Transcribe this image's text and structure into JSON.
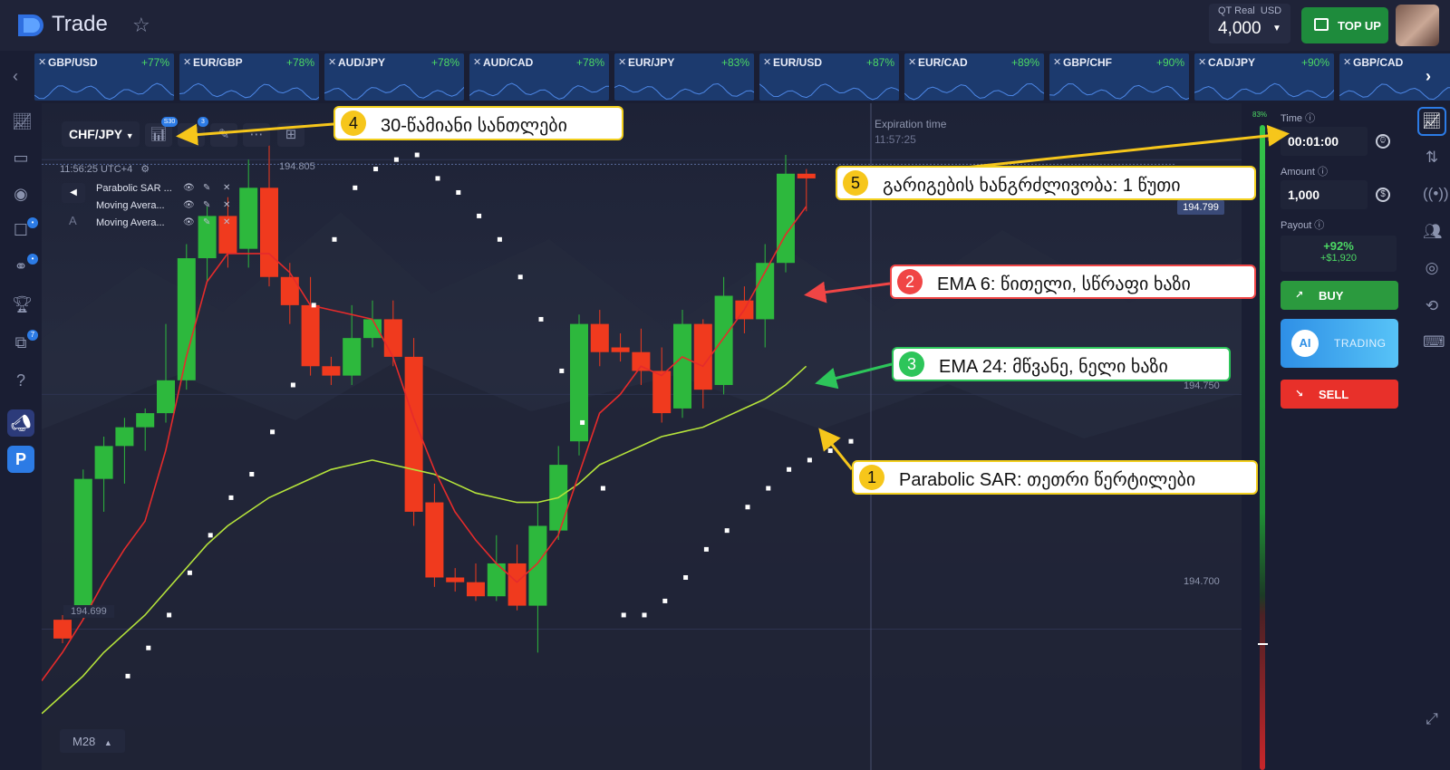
{
  "header": {
    "brand": "Trade",
    "account_type": "QT Real",
    "account_currency": "USD",
    "balance": "4,000",
    "top_up_label": "TOP UP"
  },
  "tickers": [
    {
      "pair": "GBP/USD",
      "payout": "+77%"
    },
    {
      "pair": "EUR/GBP",
      "payout": "+78%"
    },
    {
      "pair": "AUD/JPY",
      "payout": "+78%"
    },
    {
      "pair": "AUD/CAD",
      "payout": "+78%"
    },
    {
      "pair": "EUR/JPY",
      "payout": "+83%"
    },
    {
      "pair": "EUR/USD",
      "payout": "+87%"
    },
    {
      "pair": "EUR/CAD",
      "payout": "+89%"
    },
    {
      "pair": "GBP/CHF",
      "payout": "+90%"
    },
    {
      "pair": "CAD/JPY",
      "payout": "+90%"
    },
    {
      "pair": "GBP/CAD",
      "payout": ""
    }
  ],
  "chart": {
    "symbol": "CHF/JPY",
    "candle_badge": "S30",
    "indicator_badge": "3",
    "server_time": "11:56:25 UTC+4",
    "high_price": "194.805",
    "low_price": "194.699",
    "current_price": "194.799",
    "price_levels": [
      "194.750",
      "194.700"
    ],
    "expiration_label": "Expiration time",
    "expiration_value": "11:57:25",
    "timeframe": "M28",
    "indicators": [
      {
        "name": "Parabolic SAR ..."
      },
      {
        "name": "Moving Avera..."
      },
      {
        "name": "Moving Avera..."
      }
    ],
    "colors": {
      "up": "#2db83d",
      "down": "#f03a1e",
      "ema_fast": "#e52b2b",
      "ema_slow": "#b5e33b",
      "sar": "#ffffff"
    }
  },
  "callouts": [
    {
      "num": "4",
      "text": "30-წამიანი სანთლები"
    },
    {
      "num": "5",
      "text": "გარიგების ხანგრძლივობა: 1 წუთი"
    },
    {
      "num": "2",
      "text": "EMA 6: წითელი, სწრაფი ხაზი"
    },
    {
      "num": "3",
      "text": "EMA 24: მწვანე, ნელი ხაზი"
    },
    {
      "num": "1",
      "text": "Parabolic SAR: თეთრი წერტილები"
    }
  ],
  "panel": {
    "sentiment": "83%",
    "time_label": "Time",
    "time_value": "00:01:00",
    "amount_label": "Amount",
    "amount_value": "1,000",
    "payout_label": "Payout",
    "payout_pct": "+92%",
    "payout_amount": "+$1,920",
    "buy_label": "BUY",
    "ai_label": "TRADING",
    "ai_icon_text": "AI",
    "sell_label": "SELL"
  },
  "candles": [
    {
      "o": 194.702,
      "c": 194.698,
      "h": 194.703,
      "l": 194.697
    },
    {
      "o": 194.703,
      "c": 194.732,
      "h": 194.734,
      "l": 194.702
    },
    {
      "o": 194.732,
      "c": 194.739,
      "h": 194.741,
      "l": 194.725
    },
    {
      "o": 194.739,
      "c": 194.743,
      "h": 194.745,
      "l": 194.731
    },
    {
      "o": 194.743,
      "c": 194.746,
      "h": 194.747,
      "l": 194.738
    },
    {
      "o": 194.746,
      "c": 194.753,
      "h": 194.765,
      "l": 194.744
    },
    {
      "o": 194.753,
      "c": 194.779,
      "h": 194.782,
      "l": 194.751
    },
    {
      "o": 194.779,
      "c": 194.788,
      "h": 194.79,
      "l": 194.774
    },
    {
      "o": 194.788,
      "c": 194.78,
      "h": 194.792,
      "l": 194.777
    },
    {
      "o": 194.781,
      "c": 194.794,
      "h": 194.8,
      "l": 194.777
    },
    {
      "o": 194.794,
      "c": 194.775,
      "h": 194.803,
      "l": 194.773
    },
    {
      "o": 194.775,
      "c": 194.769,
      "h": 194.778,
      "l": 194.765
    },
    {
      "o": 194.769,
      "c": 194.756,
      "h": 194.775,
      "l": 194.754
    },
    {
      "o": 194.756,
      "c": 194.754,
      "h": 194.758,
      "l": 194.752
    },
    {
      "o": 194.754,
      "c": 194.762,
      "h": 194.769,
      "l": 194.752
    },
    {
      "o": 194.762,
      "c": 194.766,
      "h": 194.77,
      "l": 194.76
    },
    {
      "o": 194.766,
      "c": 194.758,
      "h": 194.77,
      "l": 194.756
    },
    {
      "o": 194.758,
      "c": 194.725,
      "h": 194.762,
      "l": 194.722
    },
    {
      "o": 194.727,
      "c": 194.711,
      "h": 194.731,
      "l": 194.709
    },
    {
      "o": 194.711,
      "c": 194.71,
      "h": 194.713,
      "l": 194.708
    },
    {
      "o": 194.71,
      "c": 194.707,
      "h": 194.714,
      "l": 194.706
    },
    {
      "o": 194.707,
      "c": 194.714,
      "h": 194.72,
      "l": 194.706
    },
    {
      "o": 194.714,
      "c": 194.705,
      "h": 194.718,
      "l": 194.704
    },
    {
      "o": 194.705,
      "c": 194.722,
      "h": 194.727,
      "l": 194.695
    },
    {
      "o": 194.721,
      "c": 194.735,
      "h": 194.739,
      "l": 194.719
    },
    {
      "o": 194.74,
      "c": 194.765,
      "h": 194.767,
      "l": 194.737
    },
    {
      "o": 194.765,
      "c": 194.759,
      "h": 194.768,
      "l": 194.756
    },
    {
      "o": 194.76,
      "c": 194.759,
      "h": 194.763,
      "l": 194.757
    },
    {
      "o": 194.759,
      "c": 194.755,
      "h": 194.764,
      "l": 194.752
    },
    {
      "o": 194.755,
      "c": 194.746,
      "h": 194.76,
      "l": 194.744
    },
    {
      "o": 194.747,
      "c": 194.765,
      "h": 194.768,
      "l": 194.745
    },
    {
      "o": 194.765,
      "c": 194.751,
      "h": 194.766,
      "l": 194.747
    },
    {
      "o": 194.752,
      "c": 194.771,
      "h": 194.775,
      "l": 194.75
    },
    {
      "o": 194.77,
      "c": 194.766,
      "h": 194.773,
      "l": 194.763
    },
    {
      "o": 194.766,
      "c": 194.778,
      "h": 194.782,
      "l": 194.76
    },
    {
      "o": 194.778,
      "c": 194.797,
      "h": 194.801,
      "l": 194.776
    },
    {
      "o": 194.797,
      "c": 194.796,
      "h": 194.798,
      "l": 194.789
    }
  ],
  "sar": [
    194.69,
    194.696,
    194.703,
    194.712,
    194.72,
    194.728,
    194.733,
    194.742,
    194.752,
    194.769,
    194.783,
    194.794,
    194.798,
    194.8,
    194.801,
    194.796,
    194.793,
    194.788,
    194.783,
    194.775,
    194.766,
    194.755,
    194.744,
    194.73,
    194.703,
    194.703,
    194.706,
    194.711,
    194.717,
    194.721,
    194.726,
    194.73,
    194.734,
    194.736,
    194.738,
    194.74
  ],
  "ema6": [
    194.689,
    194.695,
    194.702,
    194.71,
    194.717,
    194.723,
    194.738,
    194.758,
    194.774,
    194.78,
    194.78,
    194.78,
    194.776,
    194.769,
    194.768,
    194.767,
    194.766,
    194.758,
    194.745,
    194.734,
    194.725,
    194.719,
    194.714,
    194.71,
    194.714,
    194.72,
    194.733,
    194.746,
    194.75,
    194.756,
    194.754,
    194.758,
    194.756,
    194.762,
    194.768,
    194.776,
    194.784,
    194.79
  ],
  "ema24": [
    194.682,
    194.686,
    194.69,
    194.695,
    194.699,
    194.703,
    194.708,
    194.713,
    194.718,
    194.722,
    194.725,
    194.728,
    194.73,
    194.732,
    194.734,
    194.735,
    194.736,
    194.735,
    194.734,
    194.733,
    194.731,
    194.729,
    194.728,
    194.727,
    194.727,
    194.728,
    194.731,
    194.735,
    194.737,
    194.739,
    194.741,
    194.742,
    194.743,
    194.745,
    194.747,
    194.749,
    194.752,
    194.756
  ]
}
